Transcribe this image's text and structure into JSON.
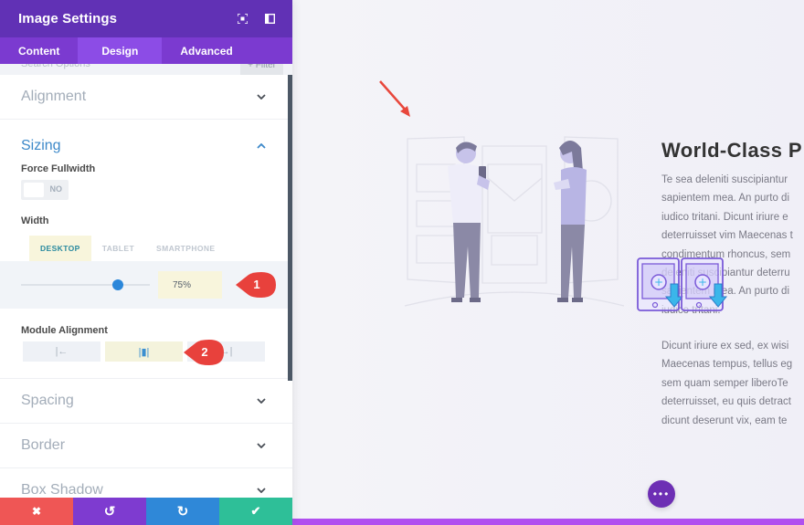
{
  "panel": {
    "title": "Image Settings",
    "header_icons": [
      "fullscreen-icon",
      "sidebar-toggle-icon"
    ],
    "tabs": [
      {
        "label": "Content",
        "active": false
      },
      {
        "label": "Design",
        "active": true
      },
      {
        "label": "Advanced",
        "active": false
      }
    ],
    "search_placeholder": "Search Options",
    "filter_label": "+ Filter",
    "groups": {
      "alignment": {
        "title": "Alignment"
      },
      "sizing": {
        "title": "Sizing",
        "force_fullwidth": {
          "label": "Force Fullwidth",
          "value": "NO"
        },
        "width": {
          "label": "Width",
          "device_tabs": [
            {
              "label": "DESKTOP",
              "active": true
            },
            {
              "label": "TABLET",
              "active": false
            },
            {
              "label": "SMARTPHONE",
              "active": false
            }
          ],
          "value": "75%",
          "slider_percent": 75
        },
        "module_alignment": {
          "label": "Module Alignment",
          "options": [
            {
              "name": "left",
              "glyph": "|←",
              "active": false
            },
            {
              "name": "center",
              "glyph": "|▮|",
              "active": true
            },
            {
              "name": "right",
              "glyph": "→|",
              "active": false
            }
          ]
        }
      },
      "spacing": {
        "title": "Spacing"
      },
      "border": {
        "title": "Border"
      },
      "box_shadow": {
        "title": "Box Shadow"
      }
    },
    "bottom_bar": {
      "discard": "✖",
      "undo": "↺",
      "redo": "↻",
      "save": "✔"
    },
    "annotations": [
      {
        "number": "1"
      },
      {
        "number": "2"
      }
    ]
  },
  "preview": {
    "heading": "World-Class P",
    "paragraph1": [
      "Te sea deleniti suscipiantur",
      "sapientem mea. An purto di",
      "iudico tritani. Dicunt iriure e",
      "deterruisset vim Maecenas t",
      "condimentum rhoncus, sem",
      "deleniti suscipiantur deterru",
      "sapientem mea. An purto di",
      "iudico tritani."
    ],
    "paragraph2": [
      "Dicunt iriure ex sed, ex wisi",
      "Maecenas tempus, tellus eg",
      "sem quam semper liberoTe",
      "deterruisset, eu quis detract",
      "dicunt deserunt vix, eam te"
    ],
    "more_button": "•••"
  },
  "colors": {
    "header": "#6131b5",
    "tabs_bg": "#7b3ad0",
    "accent_blue": "#2b87da",
    "discard": "#ef5655",
    "undo": "#7e3bd0",
    "redo": "#2f88d8",
    "save": "#2ebf98",
    "annotation_red": "#e8413c"
  }
}
